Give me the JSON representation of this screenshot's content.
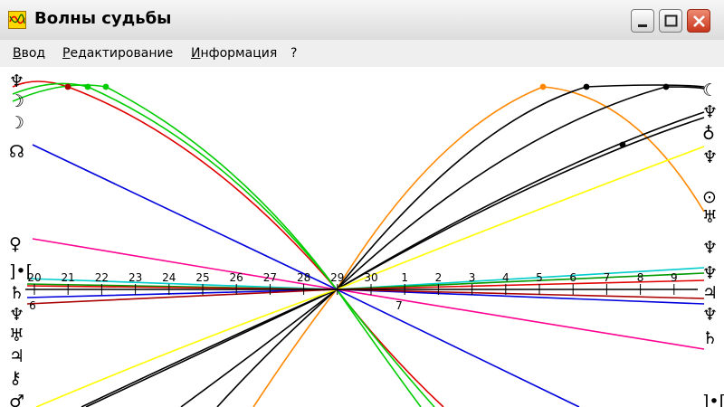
{
  "window": {
    "title": "Волны судьбы"
  },
  "menu": [
    {
      "label": "Ввод"
    },
    {
      "label": "Редактирование"
    },
    {
      "label": "Информация"
    },
    {
      "label": "?"
    }
  ],
  "axis": {
    "day_labels": [
      "20",
      "21",
      "22",
      "23",
      "24",
      "25",
      "26",
      "27",
      "28",
      "29",
      "30",
      "1",
      "2",
      "3",
      "4",
      "5",
      "6",
      "7",
      "8",
      "9"
    ],
    "secondary_labels": [
      "6",
      "7"
    ]
  },
  "symbols": {
    "left": [
      "♆",
      "☽",
      "☽",
      "☊",
      "♀",
      "]•[",
      "♄",
      "♆",
      "♅",
      "♃",
      "⚷",
      "♂"
    ],
    "right": [
      "☾",
      "♆",
      "♁",
      "♆",
      "⊙",
      "♅",
      "♆",
      "♆",
      "♃",
      "♆",
      "♄",
      "]•["
    ]
  },
  "colors": {
    "axis": "#000000",
    "curves": [
      "#e00000",
      "#00cc00",
      "#00a8ff",
      "#ff8800",
      "#000000",
      "#ffff00",
      "#0000dd",
      "#ff0090",
      "#00cccc",
      "#009900",
      "#aa0000"
    ]
  }
}
